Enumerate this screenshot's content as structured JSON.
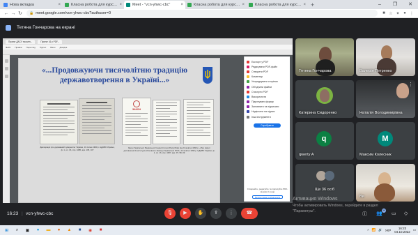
{
  "browser": {
    "tabs": [
      {
        "label": "Нова вкладка",
        "color": "#4285f4",
        "active": false
      },
      {
        "label": "Класна робота для курсу \"ПО\"",
        "color": "#34a853",
        "active": false
      },
      {
        "label": "Meet - \"vcn-yhwc-cbc\"",
        "color": "#00897b",
        "active": true
      },
      {
        "label": "Класна робота для курсу \"ПО\"",
        "color": "#34a853",
        "active": false
      },
      {
        "label": "Класна робота для курсу \"ПО\"",
        "color": "#34a853",
        "active": false
      }
    ],
    "url": "meet.google.com/vcn-yhwc-cbc?authuser=0"
  },
  "meet": {
    "presenter_text": "Тетяна Гончарова на екрані",
    "clock": "16:23",
    "meeting_code": "vcn-yhwc-cbc",
    "participants_badge": "30"
  },
  "slide": {
    "title": "«...Продовжуючи тисячолітню традицію державотворення в Україні...»",
    "caption_left": "Декларація про державний суверенітет України, 16 липня 1990 р. ЦДАВО України, ф. 1, оп. 16, спр. 4485, арк. 105, 107",
    "caption_right": "Закон Української Радянської Соціалістичної Республіки від 24 жовтня 1990 р. «Про зміни і доповнення Конституції (Основного Закону) Української РСР», 24 жовтня 1990 р. ЦДАВО України, ф. 1, оп. 16, спр. 4487, арк. 97, 98, 99",
    "doc_label": "ЗАКОН"
  },
  "pdf": {
    "tabs": [
      "Проект ДАСУ поколін...",
      "Проект 16 у PDF..."
    ],
    "menu": [
      "Файл",
      "Правка",
      "Перегляд",
      "Підпис",
      "Вікно",
      "Довідка"
    ],
    "tools": [
      {
        "label": "Експорт у PDF",
        "color": "#e53935"
      },
      {
        "label": "Редагувати PDF-файл",
        "color": "#d81b60"
      },
      {
        "label": "Створити PDF",
        "color": "#e53935"
      },
      {
        "label": "Коментар",
        "color": "#fbc02d"
      },
      {
        "label": "Упорядкувати сторінки",
        "color": "#43a047"
      },
      {
        "label": "Об'єднати файли",
        "color": "#8e24aa"
      },
      {
        "label": "Стиснути PDF",
        "color": "#e53935"
      },
      {
        "label": "Використати",
        "color": "#1e88e5"
      },
      {
        "label": "Підготувати форму",
        "color": "#8e24aa"
      },
      {
        "label": "Заповнити та підписати",
        "color": "#8e24aa"
      },
      {
        "label": "Надіслати на підпис",
        "color": "#3949ab"
      },
      {
        "label": "Інші інструменти",
        "color": "#757575"
      }
    ],
    "upgrade_button": "Спробувати",
    "promo_text": "Створюйте, редагуйте та підписуйте PDF-форми й угоди",
    "promo_button": "Безкоштовна пробна версія"
  },
  "participants": [
    {
      "name": "Тетяна Гончарова",
      "type": "video"
    },
    {
      "name": "Валерія Петренко",
      "type": "video"
    },
    {
      "name": "Катерина Сидоренко",
      "type": "avatar",
      "color": "#7cb342"
    },
    {
      "name": "Наталія Володимирівна",
      "type": "video"
    },
    {
      "name": "qwerty A",
      "type": "avatar",
      "initial": "q",
      "color": "#0b8043"
    },
    {
      "name": "Максим Колесник",
      "type": "avatar",
      "initial": "M",
      "color": "#00897b"
    },
    {
      "name": "Ще 36 осіб",
      "type": "more"
    },
    {
      "name": "Ви",
      "type": "self"
    }
  ],
  "watermark": {
    "line1": "Активация Windows",
    "line2": "Чтобы активировать Windows, перейдите в раздел",
    "line3": "\"Параметры\"."
  },
  "taskbar": {
    "lang": "УКР",
    "time": "16:23",
    "date": "04.10.2022"
  },
  "colors": {
    "accent": "#8ab4f8",
    "end_call": "#ea4335",
    "meet_bg": "#202124",
    "slide_title": "#2a4a9c"
  }
}
